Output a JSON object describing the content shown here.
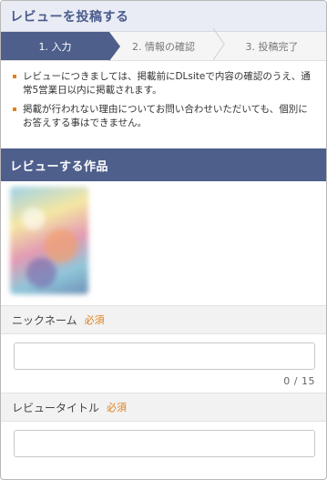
{
  "header": {
    "title": "レビューを投稿する"
  },
  "steps": [
    {
      "label": "1. 入力"
    },
    {
      "label": "2. 情報の確認"
    },
    {
      "label": "3. 投稿完了"
    }
  ],
  "notes": [
    "レビューにつきましては、掲載前にDLsiteで内容の確認のうえ、通常5営業日以内に掲載されます。",
    "掲載が行われない理由についてお問い合わせいただいても、個別にお答えする事はできません。"
  ],
  "work_section": {
    "title": "レビューする作品"
  },
  "fields": {
    "nickname": {
      "label": "ニックネーム",
      "required": "必須",
      "value": "",
      "counter": "0 / 15"
    },
    "review_title": {
      "label": "レビュータイトル",
      "required": "必須",
      "value": ""
    }
  },
  "colors": {
    "brand": "#4e5f8c",
    "accent": "#e0801c",
    "header_bg": "#e9ecf4"
  }
}
